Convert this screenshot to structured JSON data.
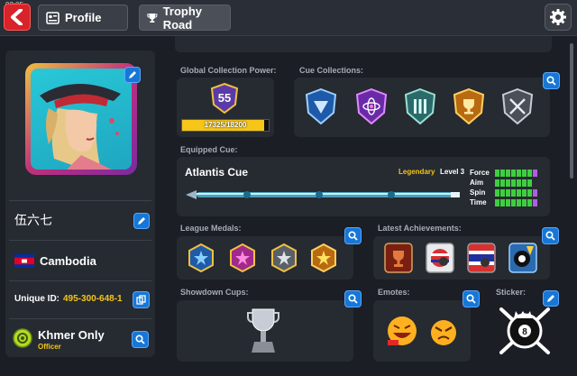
{
  "status_bar": {
    "time": "02:05"
  },
  "header": {
    "tabs": [
      {
        "label": "Profile"
      },
      {
        "label": "Trophy Road"
      }
    ]
  },
  "player": {
    "name": "伍六七",
    "country": "Cambodia",
    "unique_id_label": "Unique ID:",
    "unique_id": "495-300-648-1",
    "club_name": "Khmer Only",
    "club_role": "Officer"
  },
  "sections": {
    "global_collection_power": "Global Collection Power:",
    "cue_collections": "Cue Collections:",
    "equipped_cue": "Equipped Cue:",
    "league_medals": "League Medals:",
    "latest_achievements": "Latest Achievements:",
    "showdown_cups": "Showdown Cups:",
    "emotes": "Emotes:",
    "sticker": "Sticker:"
  },
  "collection_power": {
    "level": "55",
    "progress_text": "17325/18200",
    "progress_fraction": 0.952
  },
  "equipped_cue": {
    "name": "Atlantis Cue",
    "rarity": "Legendary",
    "level": "Level 3",
    "stats": [
      {
        "label": "Force",
        "filled": 7,
        "extra": 1
      },
      {
        "label": "Aim",
        "filled": 7,
        "extra": 0
      },
      {
        "label": "Spin",
        "filled": 7,
        "extra": 1
      },
      {
        "label": "Time",
        "filled": 7,
        "extra": 1
      }
    ]
  },
  "colors": {
    "accent_blue": "#1677d6",
    "gold": "#f5c518",
    "stat_green": "#3ecf3e",
    "stat_purple": "#b05ee0",
    "back_red": "#d8232a"
  },
  "icons": {
    "collections": [
      "blue-shield-icon",
      "purple-atom-shield-icon",
      "teal-column-shield-icon",
      "gold-trophy-shield-icon",
      "silver-swords-shield-icon"
    ],
    "medals": [
      "blue-star-medal-icon",
      "pink-star-medal-icon",
      "silver-star-medal-icon",
      "gold-star-medal-icon"
    ],
    "achievements": [
      "red-trophy-achievement-icon",
      "flag-circle-achievement-icon",
      "thailand-flag-achievement-icon",
      "eight-ball-achievement-icon"
    ]
  }
}
